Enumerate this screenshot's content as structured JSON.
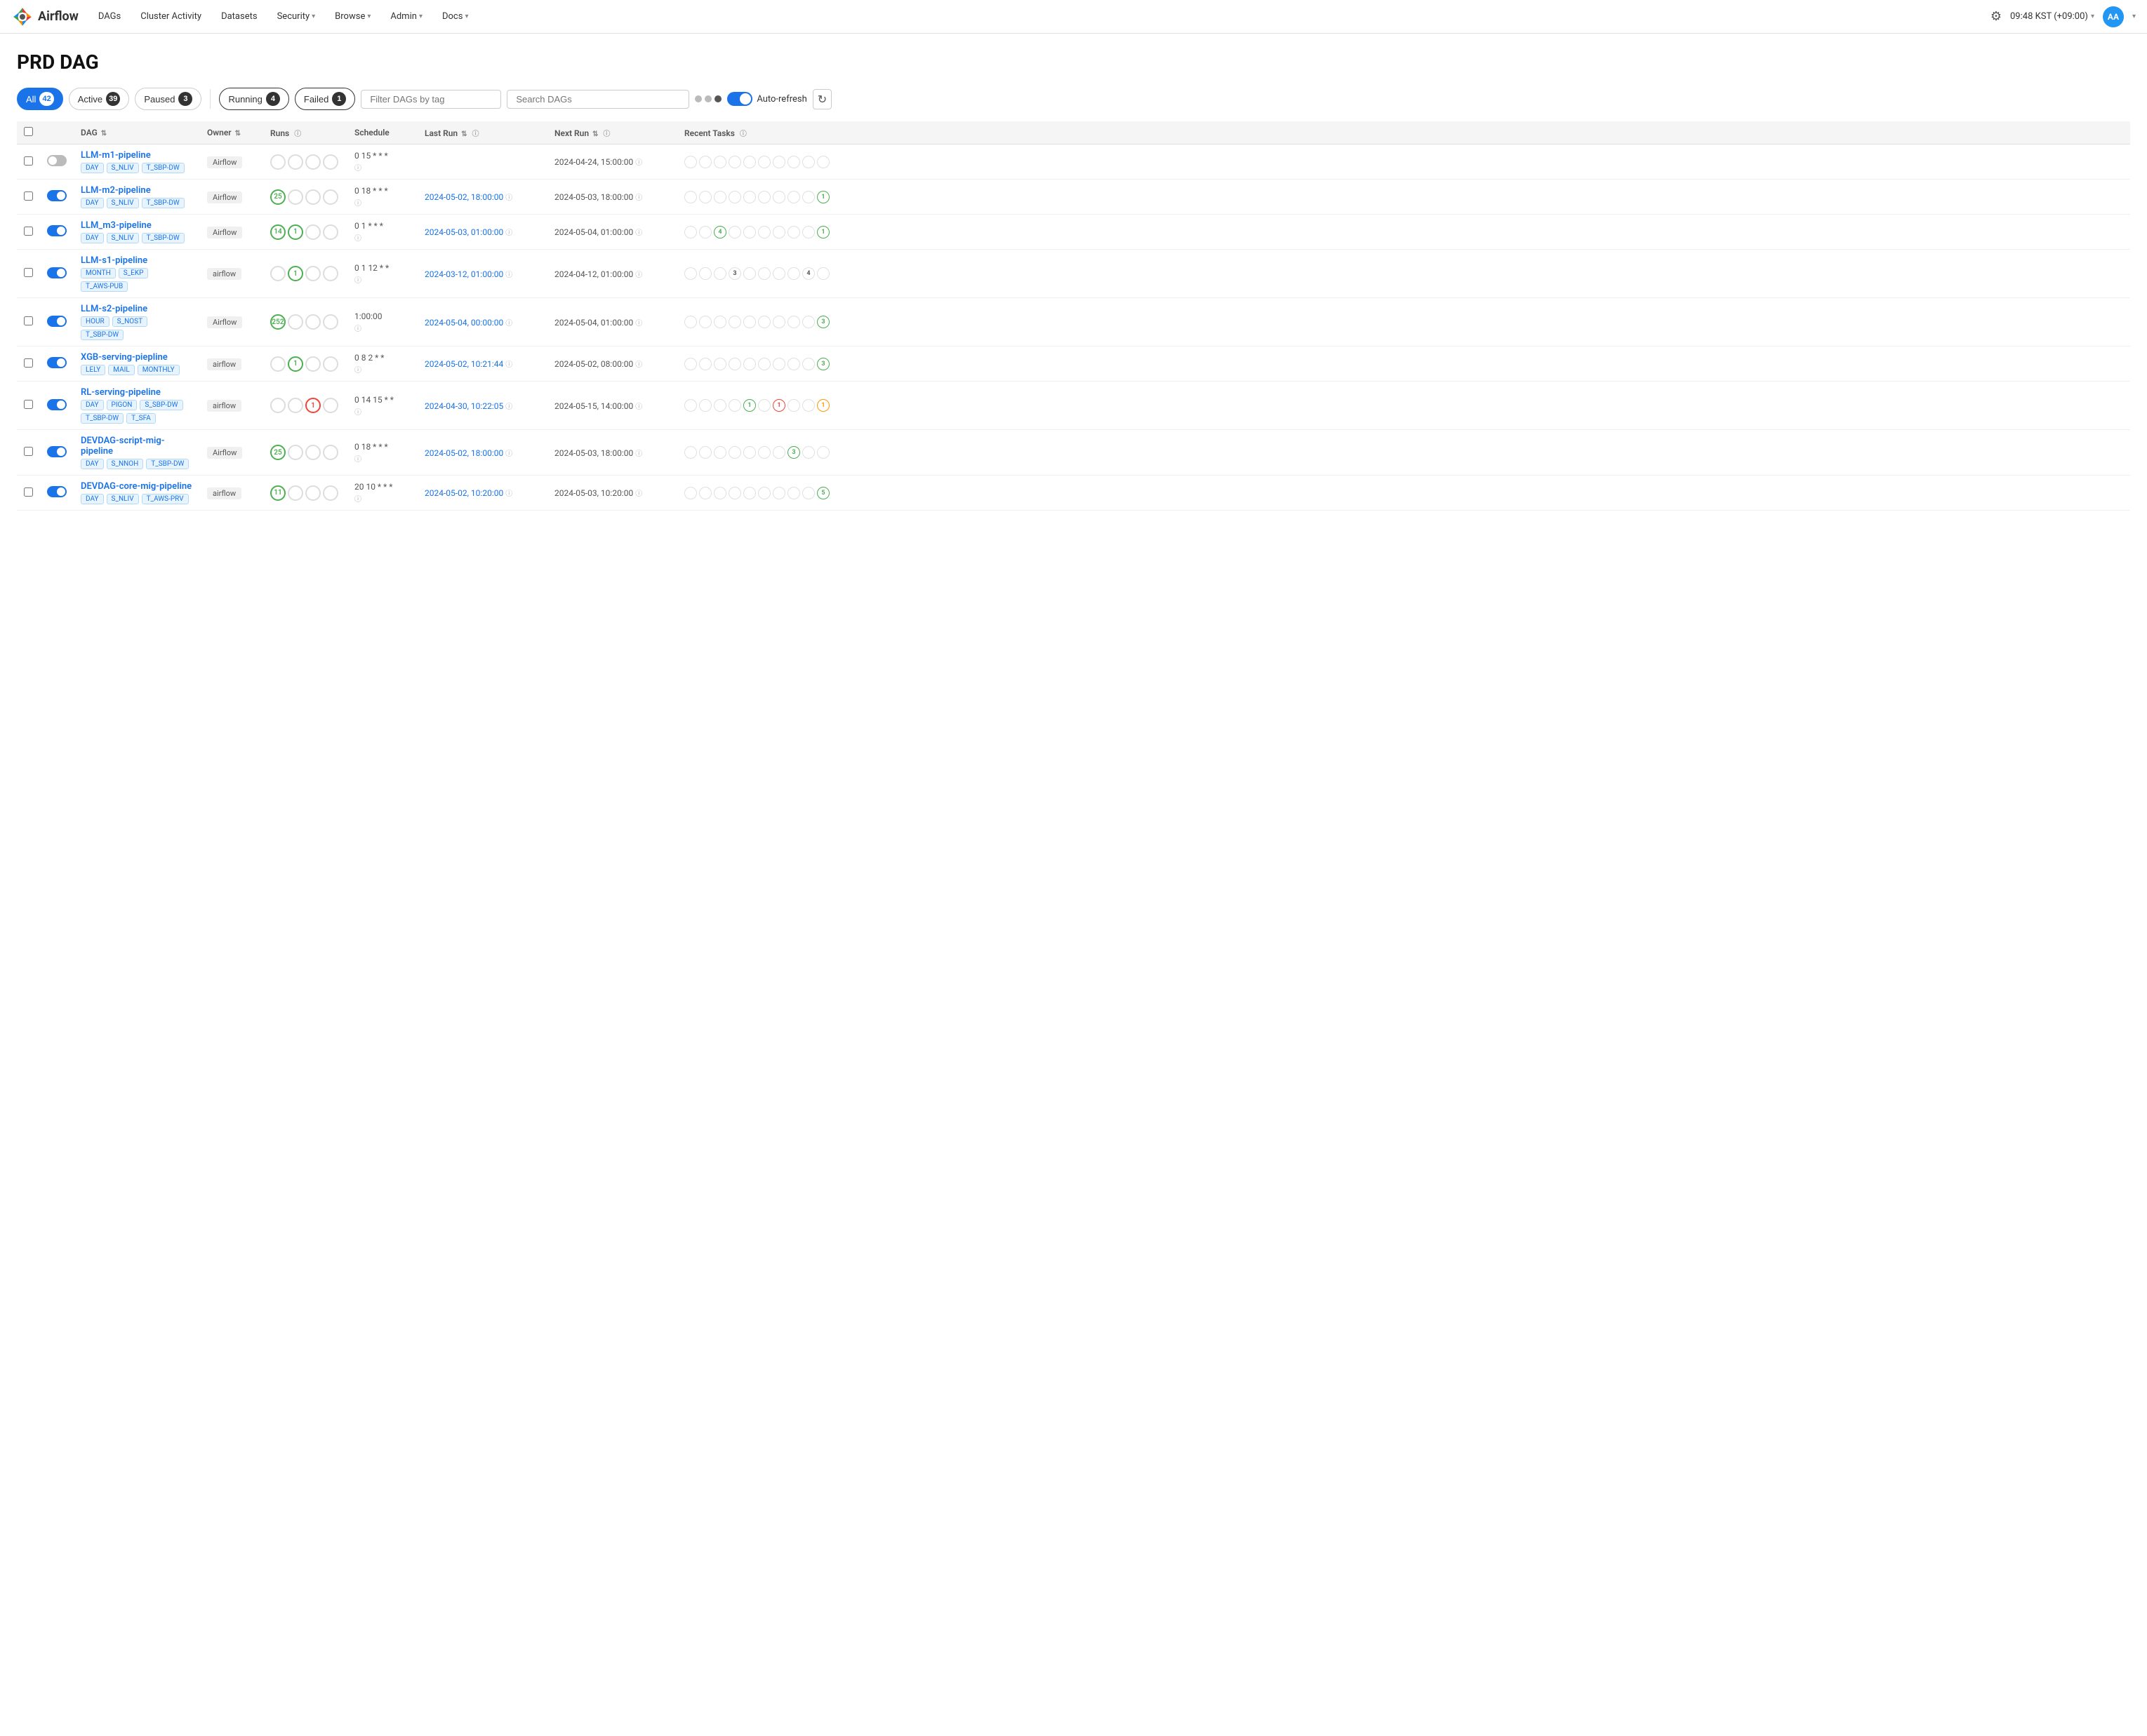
{
  "nav": {
    "logo_text": "Airflow",
    "items": [
      {
        "label": "DAGs",
        "has_arrow": false
      },
      {
        "label": "Cluster Activity",
        "has_arrow": false
      },
      {
        "label": "Datasets",
        "has_arrow": false
      },
      {
        "label": "Security",
        "has_arrow": true
      },
      {
        "label": "Browse",
        "has_arrow": true
      },
      {
        "label": "Admin",
        "has_arrow": true
      },
      {
        "label": "Docs",
        "has_arrow": true
      }
    ],
    "time": "09:48 KST (+09:00)",
    "avatar": "AA"
  },
  "page": {
    "title": "PRD DAG"
  },
  "filters": {
    "all_label": "All",
    "all_count": "42",
    "active_label": "Active",
    "active_count": "39",
    "paused_label": "Paused",
    "paused_count": "3",
    "running_label": "Running",
    "running_count": "4",
    "failed_label": "Failed",
    "failed_count": "1",
    "tag_placeholder": "Filter DAGs by tag",
    "search_placeholder": "Search DAGs",
    "auto_refresh_label": "Auto-refresh"
  },
  "table": {
    "headers": {
      "dag": "DAG",
      "owner": "Owner",
      "runs": "Runs",
      "schedule": "Schedule",
      "last_run": "Last Run",
      "next_run": "Next Run",
      "recent_tasks": "Recent Tasks"
    },
    "rows": [
      {
        "id": "LLM-m1-pipeline",
        "name": "LLM-m1-pipeline",
        "tags": [
          "DAY",
          "S_NLIV",
          "T_SBP-DW"
        ],
        "owner": "Airflow",
        "enabled": false,
        "runs": [
          {
            "type": "empty",
            "val": ""
          },
          {
            "type": "empty",
            "val": ""
          },
          {
            "type": "empty",
            "val": ""
          },
          {
            "type": "empty",
            "val": ""
          }
        ],
        "schedule": "0 15 * * *",
        "last_run": "",
        "last_run_color": "",
        "next_run": "2024-04-24, 15:00:00",
        "recent_tasks": [
          {
            "type": "empty",
            "val": ""
          },
          {
            "type": "empty",
            "val": ""
          },
          {
            "type": "empty",
            "val": ""
          },
          {
            "type": "empty",
            "val": ""
          },
          {
            "type": "empty",
            "val": ""
          },
          {
            "type": "empty",
            "val": ""
          },
          {
            "type": "empty",
            "val": ""
          },
          {
            "type": "empty",
            "val": ""
          },
          {
            "type": "empty",
            "val": ""
          },
          {
            "type": "empty",
            "val": ""
          }
        ]
      },
      {
        "id": "LLM-m2-pipeline",
        "name": "LLM-m2-pipeline",
        "tags": [
          "DAY",
          "S_NLIV",
          "T_SBP-DW"
        ],
        "owner": "Airflow",
        "enabled": true,
        "runs": [
          {
            "type": "green",
            "val": "25"
          },
          {
            "type": "empty",
            "val": ""
          },
          {
            "type": "empty",
            "val": ""
          },
          {
            "type": "empty",
            "val": ""
          }
        ],
        "schedule": "0 18 * * *",
        "last_run": "2024-05-02, 18:00:00",
        "last_run_color": "link",
        "next_run": "2024-05-03, 18:00:00",
        "recent_tasks": [
          {
            "type": "empty",
            "val": ""
          },
          {
            "type": "empty",
            "val": ""
          },
          {
            "type": "empty",
            "val": ""
          },
          {
            "type": "empty",
            "val": ""
          },
          {
            "type": "empty",
            "val": ""
          },
          {
            "type": "empty",
            "val": ""
          },
          {
            "type": "empty",
            "val": ""
          },
          {
            "type": "empty",
            "val": ""
          },
          {
            "type": "empty",
            "val": ""
          },
          {
            "type": "green",
            "val": "1"
          }
        ]
      },
      {
        "id": "LLM_m3-pipeline",
        "name": "LLM_m3-pipeline",
        "tags": [
          "DAY",
          "S_NLIV",
          "T_SBP-DW"
        ],
        "owner": "Airflow",
        "enabled": true,
        "runs": [
          {
            "type": "green",
            "val": "14"
          },
          {
            "type": "green",
            "val": "1"
          },
          {
            "type": "empty",
            "val": ""
          },
          {
            "type": "empty",
            "val": ""
          }
        ],
        "schedule": "0 1 * * *",
        "last_run": "2024-05-03, 01:00:00",
        "last_run_color": "link",
        "next_run": "2024-05-04, 01:00:00",
        "recent_tasks": [
          {
            "type": "empty",
            "val": ""
          },
          {
            "type": "empty",
            "val": ""
          },
          {
            "type": "green",
            "val": "4"
          },
          {
            "type": "empty",
            "val": ""
          },
          {
            "type": "empty",
            "val": ""
          },
          {
            "type": "empty",
            "val": ""
          },
          {
            "type": "empty",
            "val": ""
          },
          {
            "type": "empty",
            "val": ""
          },
          {
            "type": "empty",
            "val": ""
          },
          {
            "type": "green",
            "val": "1"
          }
        ]
      },
      {
        "id": "LLM-s1-pipeline",
        "name": "LLM-s1-pipeline",
        "tags": [
          "MONTH",
          "S_EKP",
          "T_AWS-PUB"
        ],
        "owner": "airflow",
        "enabled": true,
        "runs": [
          {
            "type": "empty",
            "val": ""
          },
          {
            "type": "green",
            "val": "1"
          },
          {
            "type": "empty",
            "val": ""
          },
          {
            "type": "empty",
            "val": ""
          }
        ],
        "schedule": "0 1 12 * *",
        "last_run": "2024-03-12, 01:00:00",
        "last_run_color": "link",
        "next_run": "2024-04-12, 01:00:00",
        "recent_tasks": [
          {
            "type": "empty",
            "val": ""
          },
          {
            "type": "empty",
            "val": ""
          },
          {
            "type": "empty",
            "val": ""
          },
          {
            "type": "empty",
            "val": "3"
          },
          {
            "type": "empty",
            "val": ""
          },
          {
            "type": "empty",
            "val": ""
          },
          {
            "type": "empty",
            "val": ""
          },
          {
            "type": "empty",
            "val": ""
          },
          {
            "type": "empty",
            "val": "4"
          },
          {
            "type": "empty",
            "val": ""
          }
        ]
      },
      {
        "id": "LLM-s2-pipeline",
        "name": "LLM-s2-pipeline",
        "tags": [
          "HOUR",
          "S_NOST",
          "T_SBP-DW"
        ],
        "owner": "Airflow",
        "enabled": true,
        "runs": [
          {
            "type": "green",
            "val": "252"
          },
          {
            "type": "empty",
            "val": ""
          },
          {
            "type": "empty",
            "val": ""
          },
          {
            "type": "empty",
            "val": ""
          }
        ],
        "schedule": "1:00:00",
        "last_run": "2024-05-04, 00:00:00",
        "last_run_color": "link",
        "next_run": "2024-05-04, 01:00:00",
        "recent_tasks": [
          {
            "type": "empty",
            "val": ""
          },
          {
            "type": "empty",
            "val": ""
          },
          {
            "type": "empty",
            "val": ""
          },
          {
            "type": "empty",
            "val": ""
          },
          {
            "type": "empty",
            "val": ""
          },
          {
            "type": "empty",
            "val": ""
          },
          {
            "type": "empty",
            "val": ""
          },
          {
            "type": "empty",
            "val": ""
          },
          {
            "type": "empty",
            "val": ""
          },
          {
            "type": "green",
            "val": "3"
          }
        ]
      },
      {
        "id": "XGB-serving-piepline",
        "name": "XGB-serving-piepline",
        "tags": [
          "LELY",
          "MAIL",
          "MONTHLY"
        ],
        "owner": "airflow",
        "enabled": true,
        "runs": [
          {
            "type": "empty",
            "val": ""
          },
          {
            "type": "green",
            "val": "1"
          },
          {
            "type": "empty",
            "val": ""
          },
          {
            "type": "empty",
            "val": ""
          }
        ],
        "schedule": "0 8 2 * *",
        "last_run": "2024-05-02, 10:21:44",
        "last_run_color": "link",
        "next_run": "2024-05-02, 08:00:00",
        "recent_tasks": [
          {
            "type": "empty",
            "val": ""
          },
          {
            "type": "empty",
            "val": ""
          },
          {
            "type": "empty",
            "val": ""
          },
          {
            "type": "empty",
            "val": ""
          },
          {
            "type": "empty",
            "val": ""
          },
          {
            "type": "empty",
            "val": ""
          },
          {
            "type": "empty",
            "val": ""
          },
          {
            "type": "empty",
            "val": ""
          },
          {
            "type": "empty",
            "val": ""
          },
          {
            "type": "green",
            "val": "3"
          }
        ]
      },
      {
        "id": "RL-serving-pipeline",
        "name": "RL-serving-pipeline",
        "tags": [
          "DAY",
          "PIGON",
          "S_SBP-DW",
          "T_SBP-DW",
          "T_SFA"
        ],
        "owner": "airflow",
        "enabled": true,
        "runs": [
          {
            "type": "empty",
            "val": ""
          },
          {
            "type": "empty",
            "val": ""
          },
          {
            "type": "red",
            "val": "1"
          },
          {
            "type": "empty",
            "val": ""
          }
        ],
        "schedule": "0 14 15 * *",
        "last_run": "2024-04-30, 10:22:05",
        "last_run_color": "link",
        "next_run": "2024-05-15, 14:00:00",
        "recent_tasks": [
          {
            "type": "empty",
            "val": ""
          },
          {
            "type": "empty",
            "val": ""
          },
          {
            "type": "empty",
            "val": ""
          },
          {
            "type": "empty",
            "val": ""
          },
          {
            "type": "green",
            "val": "1"
          },
          {
            "type": "empty",
            "val": ""
          },
          {
            "type": "red",
            "val": "1"
          },
          {
            "type": "empty",
            "val": ""
          },
          {
            "type": "empty",
            "val": ""
          },
          {
            "type": "yellow",
            "val": "1"
          }
        ]
      },
      {
        "id": "DEVDAG-script-mig-pipeline",
        "name": "DEVDAG-script-mig-pipeline",
        "tags": [
          "DAY",
          "S_NNOH",
          "T_SBP-DW"
        ],
        "owner": "Airflow",
        "enabled": true,
        "runs": [
          {
            "type": "green",
            "val": "25"
          },
          {
            "type": "empty",
            "val": ""
          },
          {
            "type": "empty",
            "val": ""
          },
          {
            "type": "empty",
            "val": ""
          }
        ],
        "schedule": "0 18 * * *",
        "last_run": "2024-05-02, 18:00:00",
        "last_run_color": "link",
        "next_run": "2024-05-03, 18:00:00",
        "recent_tasks": [
          {
            "type": "empty",
            "val": ""
          },
          {
            "type": "empty",
            "val": ""
          },
          {
            "type": "empty",
            "val": ""
          },
          {
            "type": "empty",
            "val": ""
          },
          {
            "type": "empty",
            "val": ""
          },
          {
            "type": "empty",
            "val": ""
          },
          {
            "type": "empty",
            "val": ""
          },
          {
            "type": "green",
            "val": "3"
          },
          {
            "type": "empty",
            "val": ""
          },
          {
            "type": "empty",
            "val": ""
          }
        ]
      },
      {
        "id": "DEVDAG-core-mig-pipeline",
        "name": "DEVDAG-core-mig-pipeline",
        "tags": [
          "DAY",
          "S_NLIV",
          "T_AWS-PRV"
        ],
        "owner": "airflow",
        "enabled": true,
        "runs": [
          {
            "type": "green",
            "val": "11"
          },
          {
            "type": "empty",
            "val": ""
          },
          {
            "type": "empty",
            "val": ""
          },
          {
            "type": "empty",
            "val": ""
          }
        ],
        "schedule": "20 10 * * *",
        "last_run": "2024-05-02, 10:20:00",
        "last_run_color": "link",
        "next_run": "2024-05-03, 10:20:00",
        "recent_tasks": [
          {
            "type": "empty",
            "val": ""
          },
          {
            "type": "empty",
            "val": ""
          },
          {
            "type": "empty",
            "val": ""
          },
          {
            "type": "empty",
            "val": ""
          },
          {
            "type": "empty",
            "val": ""
          },
          {
            "type": "empty",
            "val": ""
          },
          {
            "type": "empty",
            "val": ""
          },
          {
            "type": "empty",
            "val": ""
          },
          {
            "type": "empty",
            "val": ""
          },
          {
            "type": "green",
            "val": "5"
          }
        ]
      }
    ]
  }
}
